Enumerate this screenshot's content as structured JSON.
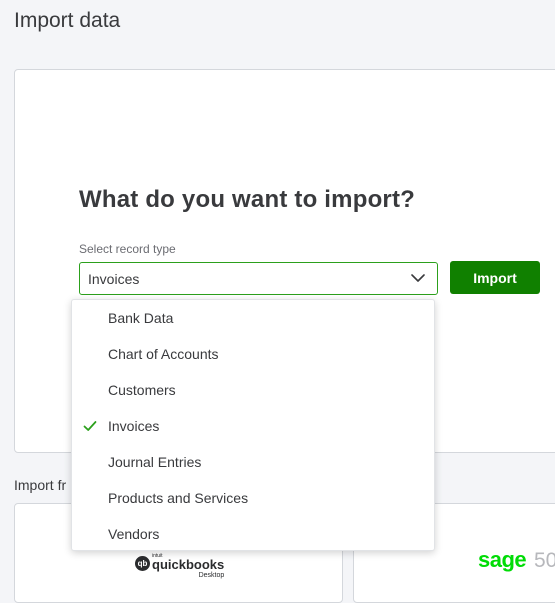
{
  "page": {
    "title": "Import data"
  },
  "import_card": {
    "heading": "What do you want to import?",
    "select_label": "Select record type",
    "selected_value": "Invoices",
    "import_button": "Import"
  },
  "dropdown": {
    "options": [
      {
        "label": "Bank Data",
        "selected": false
      },
      {
        "label": "Chart of Accounts",
        "selected": false
      },
      {
        "label": "Customers",
        "selected": false
      },
      {
        "label": "Invoices",
        "selected": true
      },
      {
        "label": "Journal Entries",
        "selected": false
      },
      {
        "label": "Products and Services",
        "selected": false
      },
      {
        "label": "Vendors",
        "selected": false
      }
    ]
  },
  "import_from": {
    "label": "Import fr",
    "sources": [
      {
        "intuit": "intuit",
        "word": "quickbooks",
        "suffix": "Desktop",
        "badge": "qb"
      },
      {
        "word": "sage",
        "suffix": "50"
      }
    ]
  },
  "colors": {
    "accent": "#2ca01c",
    "button": "#108000",
    "sage_green": "#00dc06"
  },
  "icons": {
    "select_chevron": "chevron-down-icon",
    "selected_check": "check-icon"
  }
}
